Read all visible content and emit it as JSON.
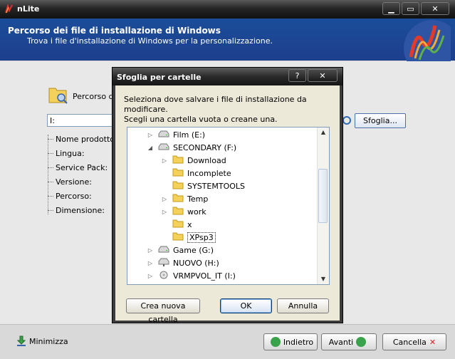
{
  "window": {
    "title": "nLite"
  },
  "header": {
    "title": "Percorso dei file di installazione di Windows",
    "subtitle": "Trova i file d'installazione di Windows per la personalizzazione."
  },
  "main": {
    "path_label": "Percorso de",
    "path_value": "I:",
    "browse_label": "Sfoglia...",
    "info_fields": [
      "Nome prodotto:",
      "Lingua:",
      "Service Pack:",
      "Versione:",
      "Percorso:",
      "Dimensione:"
    ]
  },
  "bottom": {
    "minimize_label": "Minimizza",
    "back_label": "Indietro",
    "next_label": "Avanti",
    "cancel_label": "Cancella"
  },
  "dialog": {
    "title": "Sfoglia per cartelle",
    "instruction_1": "Seleziona dove salvare i file di installazione da modificare.",
    "instruction_2": "Scegli una cartella vuota o creane una.",
    "tree": [
      {
        "label": "Film (E:)",
        "type": "drive",
        "level": 0,
        "expander": "▷"
      },
      {
        "label": "SECONDARY (F:)",
        "type": "drive",
        "level": 0,
        "expander": "◢"
      },
      {
        "label": "Download",
        "type": "folder",
        "level": 1,
        "expander": "▷"
      },
      {
        "label": "Incomplete",
        "type": "folder",
        "level": 1,
        "expander": ""
      },
      {
        "label": "SYSTEMTOOLS",
        "type": "folder",
        "level": 1,
        "expander": ""
      },
      {
        "label": "Temp",
        "type": "folder",
        "level": 1,
        "expander": "▷"
      },
      {
        "label": "work",
        "type": "folder",
        "level": 1,
        "expander": "▷"
      },
      {
        "label": "x",
        "type": "folder",
        "level": 1,
        "expander": ""
      },
      {
        "label": "XPsp3",
        "type": "folder",
        "level": 1,
        "expander": "",
        "selected": true
      },
      {
        "label": "Game (G:)",
        "type": "drive",
        "level": 0,
        "expander": "▷"
      },
      {
        "label": "NUOVO (H:)",
        "type": "netdrive",
        "level": 0,
        "expander": "▷"
      },
      {
        "label": "VRMPVOL_IT (I:)",
        "type": "cdrive",
        "level": 0,
        "expander": "▷"
      }
    ],
    "new_folder_label": "Crea nuova cartella",
    "ok_label": "OK",
    "cancel_label": "Annulla"
  },
  "colors": {
    "header_bg": "#1c4591",
    "titlebar_bg": "#1e1e1e",
    "dialog_body": "#ece9d8",
    "selection": "#316ac5"
  }
}
